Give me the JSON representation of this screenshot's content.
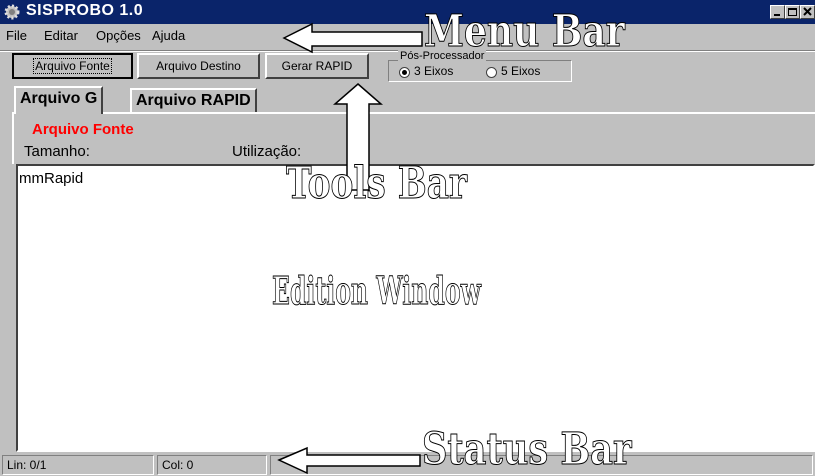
{
  "window": {
    "title": "SISPROBO 1.0",
    "icon": "gear-icon",
    "controls": [
      "minimize-icon",
      "maximize-icon",
      "close-icon"
    ]
  },
  "menu": {
    "items": [
      "File",
      "Editar",
      "Opções",
      "Ajuda"
    ]
  },
  "toolbar": {
    "arquivo_fonte": "Arquivo Fonte",
    "arquivo_destino": "Arquivo Destino",
    "gerar_rapid": "Gerar RAPID",
    "group_label": "Pós-Processador",
    "radio_3": "3 Eixos",
    "radio_5": "5 Eixos",
    "selected": "3 Eixos"
  },
  "tabs": [
    "Arquivo G",
    "Arquivo RAPID"
  ],
  "panel": {
    "title": "Arquivo Fonte",
    "tamanho": "Tamanho:",
    "utilizacao": "Utilização:"
  },
  "editor": {
    "content": "mmRapid"
  },
  "status": {
    "lin": "Lin:  0/1",
    "col": "Col:  0"
  },
  "annotations": {
    "menu_bar": "Menu Bar",
    "tools_bar": "Tools Bar",
    "edition_window": "Edition Window",
    "status_bar": "Status Bar"
  },
  "colors": {
    "titlebar": "#0a246a",
    "face": "#c0c0c0",
    "label_red": "#ff0000"
  }
}
